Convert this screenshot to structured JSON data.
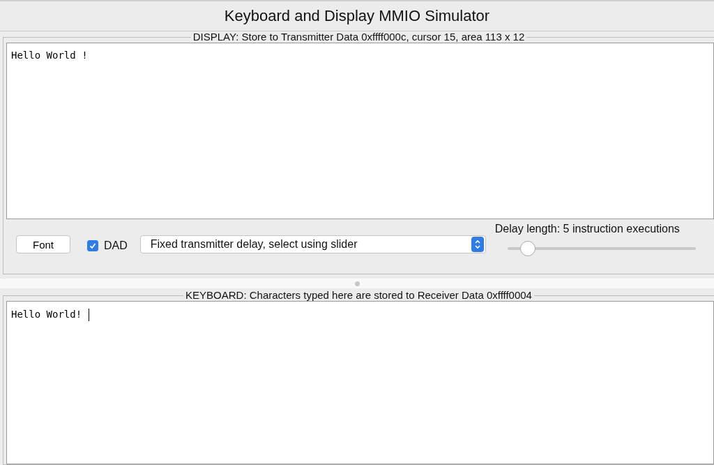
{
  "window": {
    "title": "Keyboard and Display MMIO Simulator"
  },
  "display": {
    "title": "DISPLAY: Store to Transmitter Data 0xffff000c, cursor 15, area 113 x 12",
    "text": "Hello World !"
  },
  "controls": {
    "font_button": "Font",
    "dad": {
      "label": "DAD",
      "checked": true
    },
    "delay_mode": "Fixed transmitter delay, select using slider",
    "delay_label": "Delay length: 5 instruction executions",
    "delay_slider": {
      "level": 0.1
    }
  },
  "keyboard": {
    "title": "KEYBOARD: Characters typed here are stored to Receiver Data 0xffff0004",
    "text": "Hello World! "
  }
}
